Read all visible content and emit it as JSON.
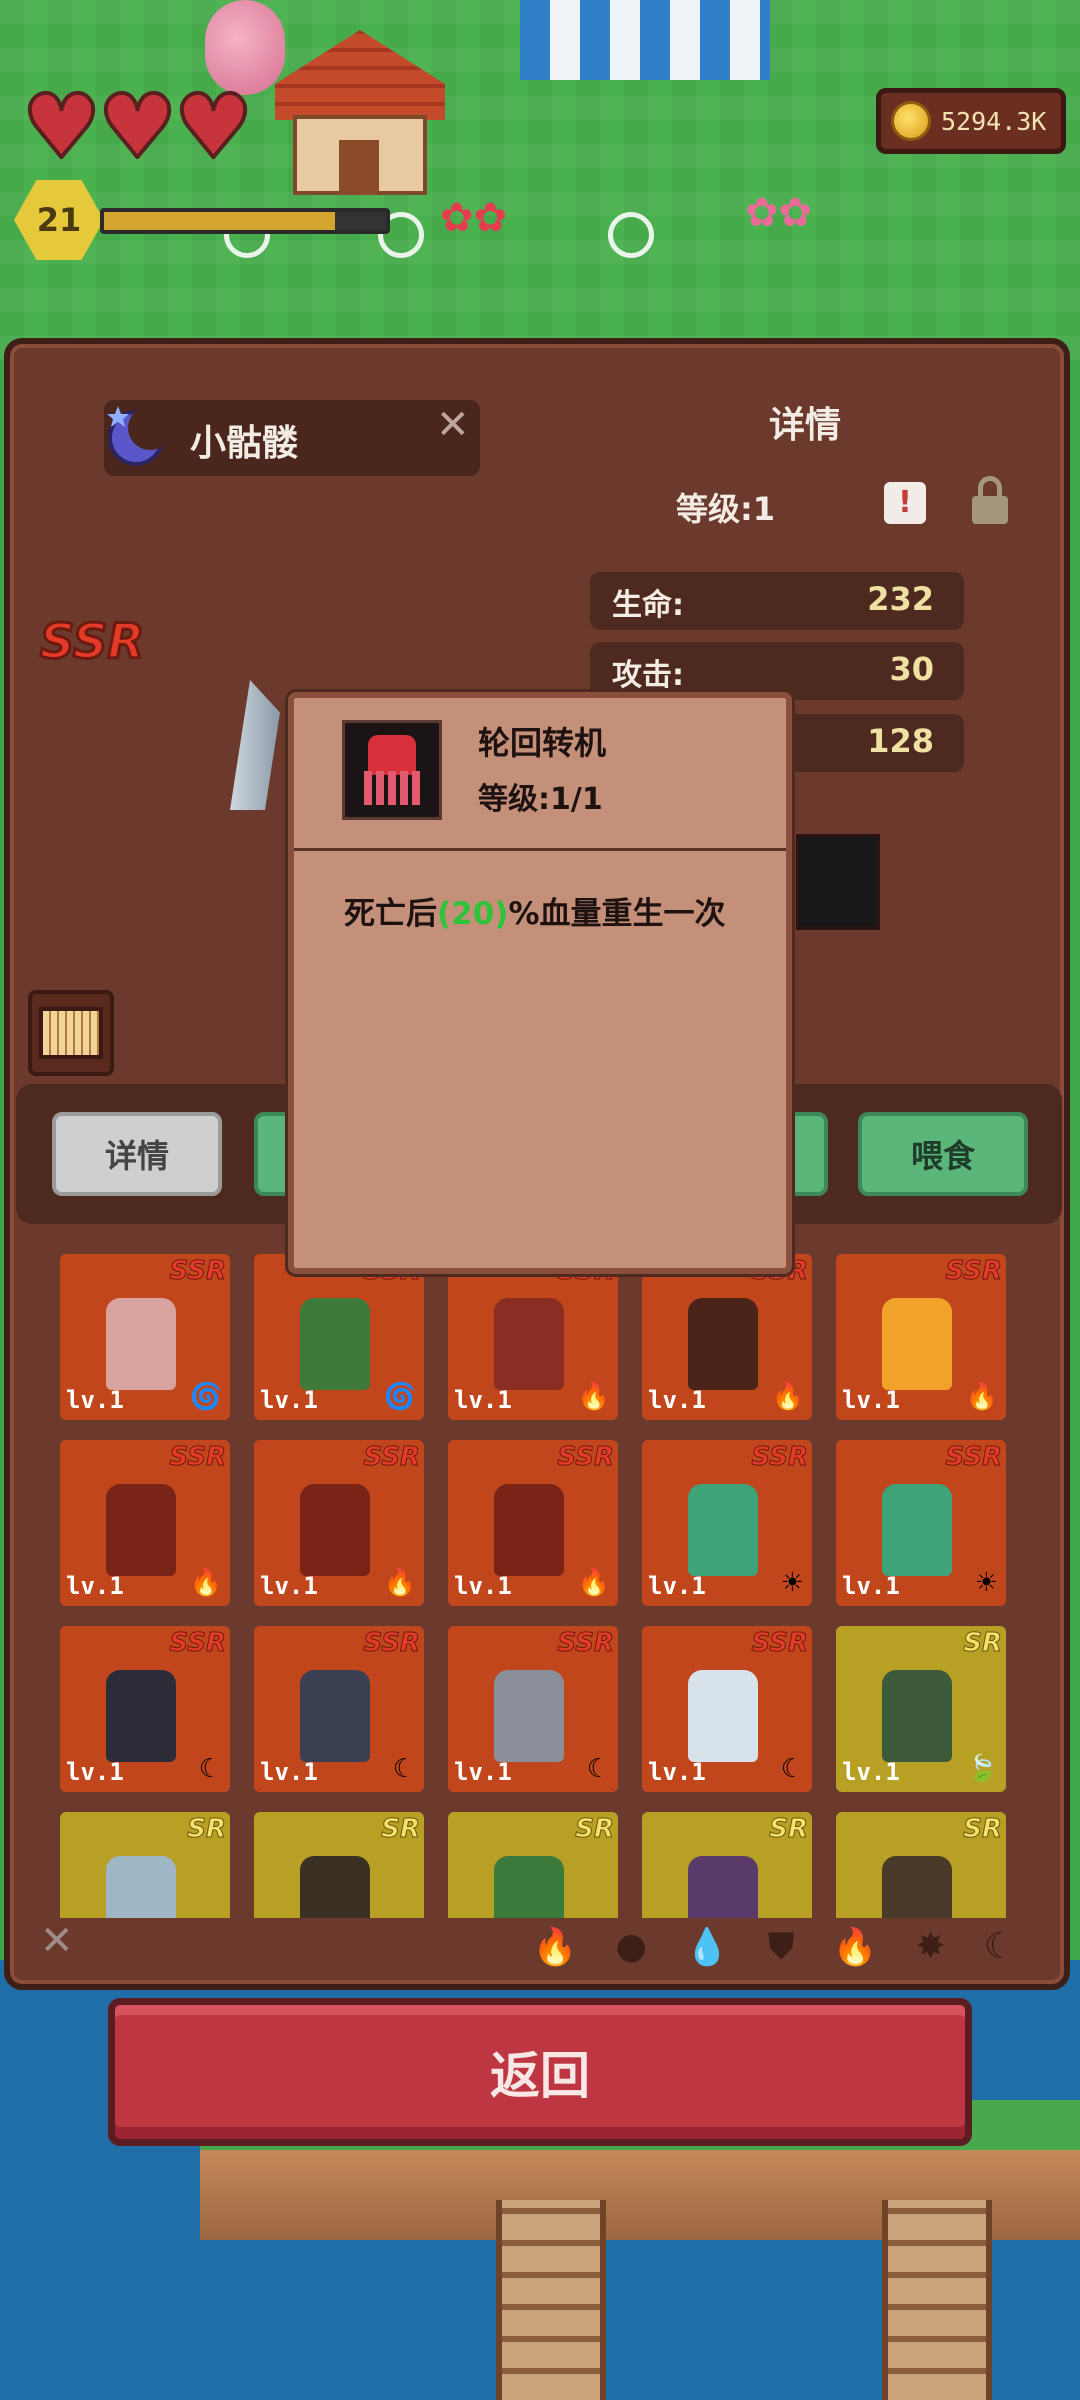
{
  "hud": {
    "player_level": "21",
    "coins": "5294.3K",
    "xp_progress": 0.82,
    "hearts": 3
  },
  "pet": {
    "name": "小骷髅",
    "rarity": "SSR",
    "details_title": "详情",
    "level": "等级:1",
    "stats": [
      {
        "label": "生命:",
        "value": "232"
      },
      {
        "label": "攻击:",
        "value": "30"
      },
      {
        "label": "",
        "value": "128"
      }
    ]
  },
  "tabs": {
    "detail": "详情",
    "feed": "喂食"
  },
  "skill_popup": {
    "title": "轮回转机",
    "level": "等级:1/1",
    "desc_prefix": "死亡后",
    "desc_value": "(20)",
    "desc_suffix": "%血量重生一次"
  },
  "pets_grid": [
    {
      "rarity": "SSR",
      "level": "lv.1",
      "element": "wind",
      "color": "#d9a3a0"
    },
    {
      "rarity": "SSR",
      "level": "lv.1",
      "element": "wind",
      "color": "#3f7a3a"
    },
    {
      "rarity": "SSR",
      "level": "lv.1",
      "element": "fire",
      "color": "#8a2d22"
    },
    {
      "rarity": "SSR",
      "level": "lv.1",
      "element": "fire",
      "color": "#4a2418"
    },
    {
      "rarity": "SSR",
      "level": "lv.1",
      "element": "fire",
      "color": "#f0a22b"
    },
    {
      "rarity": "SSR",
      "level": "lv.1",
      "element": "fire",
      "color": "#7a2418"
    },
    {
      "rarity": "SSR",
      "level": "lv.1",
      "element": "fire",
      "color": "#7a2418"
    },
    {
      "rarity": "SSR",
      "level": "lv.1",
      "element": "fire",
      "color": "#7a2418"
    },
    {
      "rarity": "SSR",
      "level": "lv.1",
      "element": "sun",
      "color": "#3fa37a"
    },
    {
      "rarity": "SSR",
      "level": "lv.1",
      "element": "sun",
      "color": "#3fa37a"
    },
    {
      "rarity": "SSR",
      "level": "lv.1",
      "element": "moon",
      "color": "#2d2d3a"
    },
    {
      "rarity": "SSR",
      "level": "lv.1",
      "element": "moon",
      "color": "#3a3f52"
    },
    {
      "rarity": "SSR",
      "level": "lv.1",
      "element": "moon",
      "color": "#8a8f9a"
    },
    {
      "rarity": "SSR",
      "level": "lv.1",
      "element": "moon",
      "color": "#d7e2ea"
    },
    {
      "rarity": "SR",
      "level": "lv.1",
      "element": "leaf",
      "color": "#3d5a3a"
    },
    {
      "rarity": "SR",
      "level": "",
      "element": "",
      "color": "#9fb6c6"
    },
    {
      "rarity": "SR",
      "level": "",
      "element": "",
      "color": "#3a3024"
    },
    {
      "rarity": "SR",
      "level": "",
      "element": "",
      "color": "#3b7a3a"
    },
    {
      "rarity": "SR",
      "level": "",
      "element": "",
      "color": "#5a3a6a"
    },
    {
      "rarity": "SR",
      "level": "",
      "element": "",
      "color": "#4a3a2a"
    }
  ],
  "element_glyphs": {
    "wind": "🌀",
    "fire": "🔥",
    "sun": "☀",
    "moon": "☾",
    "leaf": "🍃"
  },
  "filters": [
    "🔥",
    "●",
    "💧",
    "⛊",
    "🔥",
    "✸",
    "☾"
  ],
  "back_button": "返回",
  "colors": {
    "ssr_card": "#c2461c",
    "sr_card": "#b8a024",
    "highlight": "#2fc33a",
    "back": "#bf3643"
  }
}
